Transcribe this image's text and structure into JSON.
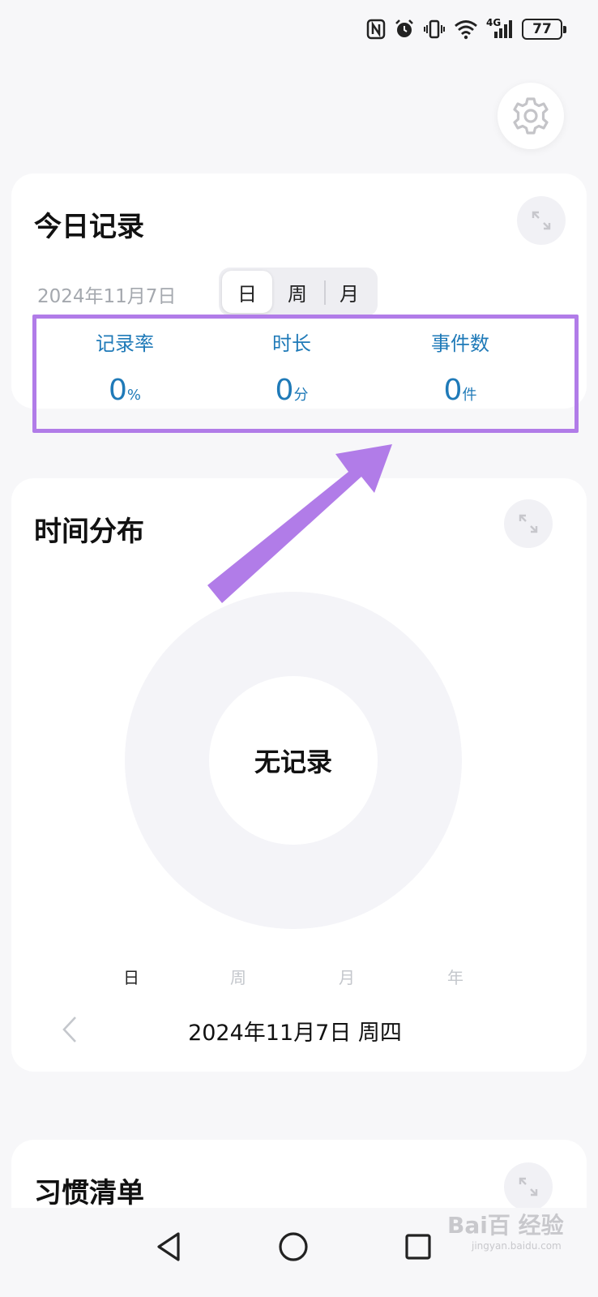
{
  "status_bar": {
    "battery_level": "77",
    "network_label": "4G",
    "icons": [
      "nfc-icon",
      "alarm-icon",
      "vibrate-icon",
      "wifi-icon",
      "signal-icon",
      "battery-icon"
    ]
  },
  "settings": {
    "icon": "gear-icon"
  },
  "today_record": {
    "title": "今日记录",
    "date": "2024年11月7日",
    "segments": [
      "日",
      "周",
      "月"
    ],
    "active_segment": "日",
    "stats": [
      {
        "label": "记录率",
        "value": "0",
        "unit": "%"
      },
      {
        "label": "时长",
        "value": "0",
        "unit": "分"
      },
      {
        "label": "事件数",
        "value": "0",
        "unit": "件"
      }
    ]
  },
  "time_distribution": {
    "title": "时间分布",
    "empty_label": "无记录",
    "ranges": [
      "日",
      "周",
      "月",
      "年"
    ],
    "active_range": "日",
    "date": "2024年11月7日 周四"
  },
  "habit_list": {
    "title": "习惯清单"
  },
  "watermark": {
    "text": "Bai百 经验",
    "sub": "jingyan.baidu.com"
  },
  "colors": {
    "accent": "#1f7ab8",
    "highlight": "#b17ce8",
    "background": "#f7f7f9",
    "card": "#ffffff"
  }
}
